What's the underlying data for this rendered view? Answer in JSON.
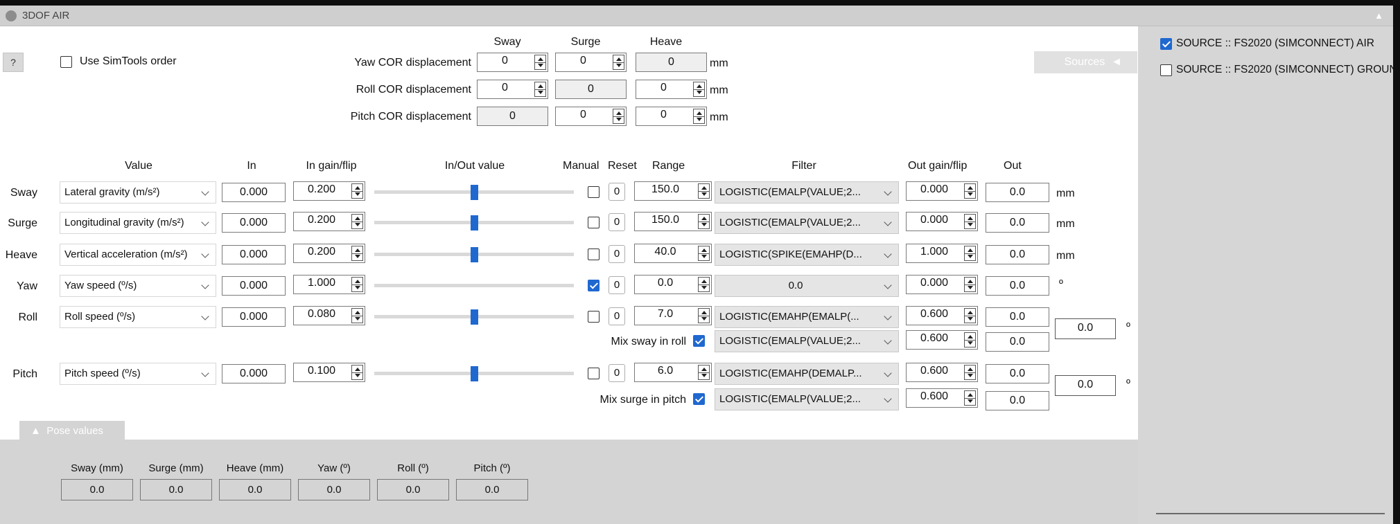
{
  "window": {
    "title": "3DOF AIR",
    "collapse_arrow": "▲"
  },
  "help": {
    "label": "?"
  },
  "use_simtools": {
    "label": "Use SimTools order",
    "checked": false
  },
  "cor": {
    "columns": [
      "Sway",
      "Surge",
      "Heave"
    ],
    "unit": "mm",
    "rows": [
      {
        "label": "Yaw COR displacement",
        "sway": "0",
        "surge": "0",
        "heave": "0"
      },
      {
        "label": "Roll COR displacement",
        "sway": "0",
        "surge": "0",
        "heave": "0"
      },
      {
        "label": "Pitch COR displacement",
        "sway": "0",
        "surge": "0",
        "heave": "0"
      }
    ]
  },
  "sources_button": {
    "label": "Sources",
    "icon": "◄"
  },
  "sources": [
    {
      "label": "SOURCE :: FS2020 (SIMCONNECT) AIR",
      "checked": true
    },
    {
      "label": "SOURCE :: FS2020 (SIMCONNECT) GROUN",
      "checked": false
    }
  ],
  "headers": {
    "value": "Value",
    "in": "In",
    "in_gain": "In gain/flip",
    "in_out": "In/Out value",
    "manual": "Manual",
    "reset": "Reset",
    "range": "Range",
    "filter": "Filter",
    "out_gain": "Out gain/flip",
    "out": "Out"
  },
  "axes": [
    {
      "name": "Sway",
      "value": "Lateral gravity (m/s²)",
      "in": "0.000",
      "in_gain": "0.200",
      "slider": 0.5,
      "manual": false,
      "reset": "0",
      "range": "150.0",
      "filter": "LOGISTIC(EMALP(VALUE;2...",
      "out_gain": "0.000",
      "out": "0.0",
      "unit": "mm"
    },
    {
      "name": "Surge",
      "value": "Longitudinal gravity (m/s²)",
      "in": "0.000",
      "in_gain": "0.200",
      "slider": 0.5,
      "manual": false,
      "reset": "0",
      "range": "150.0",
      "filter": "LOGISTIC(EMALP(VALUE;2...",
      "out_gain": "0.000",
      "out": "0.0",
      "unit": "mm"
    },
    {
      "name": "Heave",
      "value": "Vertical acceleration (m/s²)",
      "in": "0.000",
      "in_gain": "0.200",
      "slider": 0.5,
      "manual": false,
      "reset": "0",
      "range": "40.0",
      "filter": "LOGISTIC(SPIKE(EMAHP(D...",
      "out_gain": "1.000",
      "out": "0.0",
      "unit": "mm"
    },
    {
      "name": "Yaw",
      "value": "Yaw speed (º/s)",
      "in": "0.000",
      "in_gain": "1.000",
      "slider": null,
      "manual": true,
      "reset": "0",
      "range": "0.0",
      "filter": "0.0",
      "out_gain": "0.000",
      "out": "0.0",
      "unit": "º"
    },
    {
      "name": "Roll",
      "value": "Roll speed (º/s)",
      "in": "0.000",
      "in_gain": "0.080",
      "slider": 0.5,
      "manual": false,
      "reset": "0",
      "range": "7.0",
      "filter": "LOGISTIC(EMAHP(EMALP(...",
      "out_gain": "0.600",
      "out": "0.0"
    },
    {
      "name": "Pitch",
      "value": "Pitch speed (º/s)",
      "in": "0.000",
      "in_gain": "0.100",
      "slider": 0.5,
      "manual": false,
      "reset": "0",
      "range": "6.0",
      "filter": "LOGISTIC(EMAHP(DEMALP...",
      "out_gain": "0.600",
      "out": "0.0"
    }
  ],
  "mix_rows": [
    {
      "label": "Mix sway in roll",
      "checked": true,
      "filter": "LOGISTIC(EMALP(VALUE;2...",
      "out_gain": "0.600",
      "out": "0.0"
    },
    {
      "label": "Mix surge in pitch",
      "checked": true,
      "filter": "LOGISTIC(EMALP(VALUE;2...",
      "out_gain": "0.600",
      "out": "0.0"
    }
  ],
  "totals": [
    {
      "value": "0.0",
      "unit": "º"
    },
    {
      "value": "0.0",
      "unit": "º"
    }
  ],
  "pose": {
    "tab_label": "Pose values",
    "tab_icon": "▲",
    "items": [
      {
        "label": "Sway (mm)",
        "value": "0.0"
      },
      {
        "label": "Surge (mm)",
        "value": "0.0"
      },
      {
        "label": "Heave (mm)",
        "value": "0.0"
      },
      {
        "label": "Yaw (º)",
        "value": "0.0"
      },
      {
        "label": "Roll (º)",
        "value": "0.0"
      },
      {
        "label": "Pitch (º)",
        "value": "0.0"
      }
    ]
  }
}
